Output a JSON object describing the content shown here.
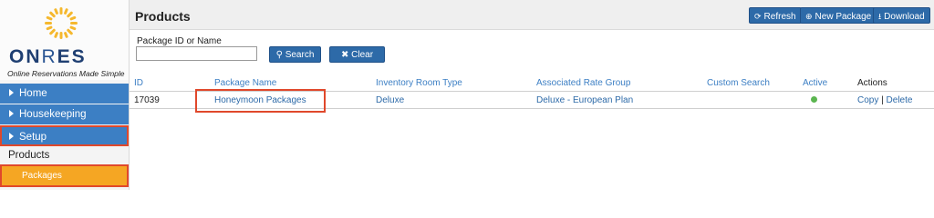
{
  "brand": {
    "logo_text_bold": "ON",
    "logo_text_thin": "R",
    "logo_text_rest": "ES",
    "tagline": "Online Reservations Made Simple",
    "accent": "#3c7fc4",
    "highlight": "#f5a623",
    "annotation": "#e0482b"
  },
  "sidebar": {
    "items": [
      {
        "label": "Home"
      },
      {
        "label": "Housekeeping"
      },
      {
        "label": "Setup"
      }
    ],
    "sub_section": "Products",
    "sub_active": "Packages"
  },
  "header": {
    "title": "Products",
    "buttons": {
      "refresh": "Refresh",
      "new_package": "New Package",
      "download": "Download"
    }
  },
  "search": {
    "label": "Package ID or Name",
    "value": "",
    "search_button": "Search",
    "clear_button": "Clear"
  },
  "table": {
    "columns": [
      "ID",
      "Package Name",
      "Inventory Room Type",
      "Associated Rate Group",
      "Custom Search",
      "Active",
      "Actions"
    ],
    "rows": [
      {
        "id": "17039",
        "name": "Honeymoon Packages",
        "room_type": "Deluxe",
        "rate_group": "Deluxe - European Plan",
        "custom_search": "",
        "active": true,
        "action_copy": "Copy",
        "action_sep": "|",
        "action_delete": "Delete"
      }
    ]
  }
}
